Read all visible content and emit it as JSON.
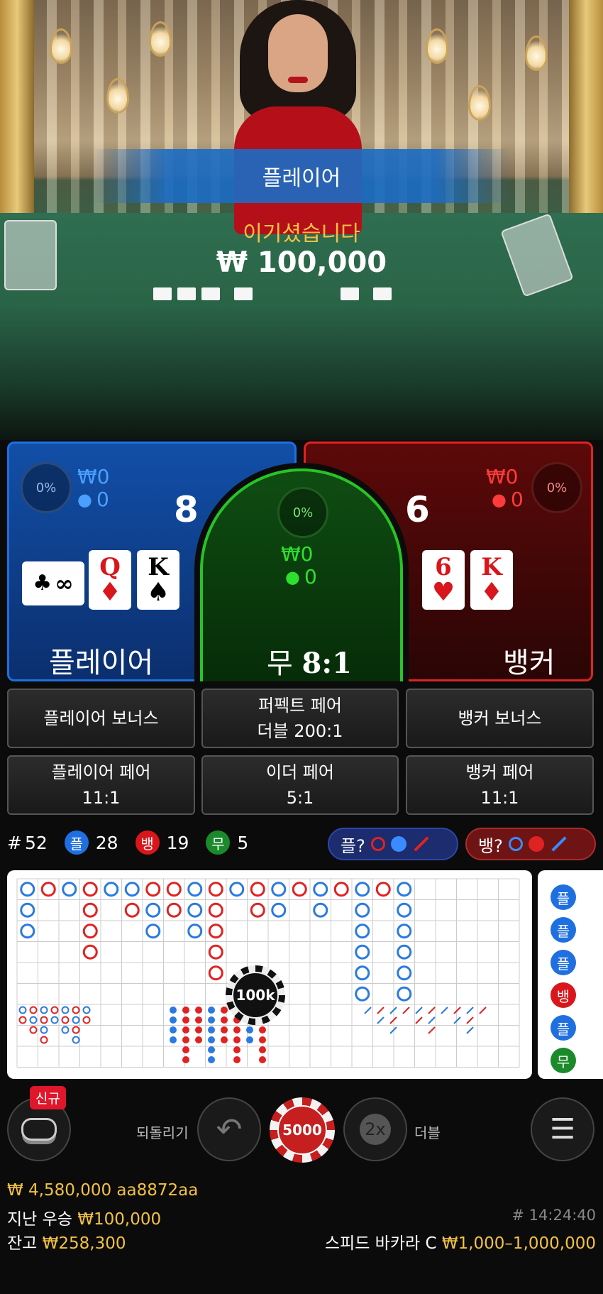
{
  "video": {
    "banner_label": "플레이어",
    "win_title": "이기셨습니다",
    "win_amount": "₩ 100,000"
  },
  "player": {
    "percent": "0%",
    "amount": "₩0",
    "players": "0",
    "score": "8",
    "label": "플레이어",
    "cards": [
      {
        "rank": "∞",
        "suit": "♣",
        "color": "black"
      },
      {
        "rank": "Q",
        "suit": "♦",
        "color": "red"
      },
      {
        "rank": "K",
        "suit": "♠",
        "color": "black"
      }
    ]
  },
  "tie": {
    "percent": "0%",
    "amount": "₩0",
    "players": "0",
    "label": "무",
    "odds": "8:1"
  },
  "banker": {
    "percent": "0%",
    "amount": "₩0",
    "players": "0",
    "score": "6",
    "label": "뱅커",
    "cards": [
      {
        "rank": "6",
        "suit": "♥",
        "color": "red"
      },
      {
        "rank": "K",
        "suit": "♦",
        "color": "red"
      }
    ]
  },
  "side_bets": {
    "player_bonus": "플레이어 보너스",
    "perfect_pair": "퍼펙트 페어",
    "perfect_pair_odds": "더블 200:1",
    "banker_bonus": "뱅커 보너스",
    "player_pair": "플레이어 페어",
    "player_pair_odds": "11:1",
    "either_pair": "이더 페어",
    "either_pair_odds": "5:1",
    "banker_pair": "뱅커 페어",
    "banker_pair_odds": "11:1"
  },
  "stats": {
    "round_prefix": "#",
    "round": "52",
    "player_char": "플",
    "player_count": "28",
    "banker_char": "뱅",
    "banker_count": "19",
    "tie_char": "무",
    "tie_count": "5",
    "player_predict": "플?",
    "banker_predict": "뱅?"
  },
  "road": {
    "chip_label": "100k",
    "side_column": [
      "플",
      "플",
      "플",
      "뱅",
      "플",
      "무"
    ]
  },
  "controls": {
    "new_badge": "신규",
    "undo_label": "되돌리기",
    "chip_value": "5000",
    "double_icon_label": "2x",
    "double_label": "더블"
  },
  "footer": {
    "last_win_amount": "₩ 4,580,000",
    "last_win_user": "aa8872aa",
    "last_win_label": "지난 우승",
    "last_win_value": "₩100,000",
    "balance_label": "잔고",
    "balance_value": "₩258,300",
    "game_id": "# 14:24:40",
    "table_name": "스피드 바카라 C",
    "limits": "₩1,000–1,000,000"
  },
  "colors": {
    "player": "#1f6fe0",
    "banker": "#e02222",
    "tie": "#26c426",
    "gold": "#f3c244"
  }
}
